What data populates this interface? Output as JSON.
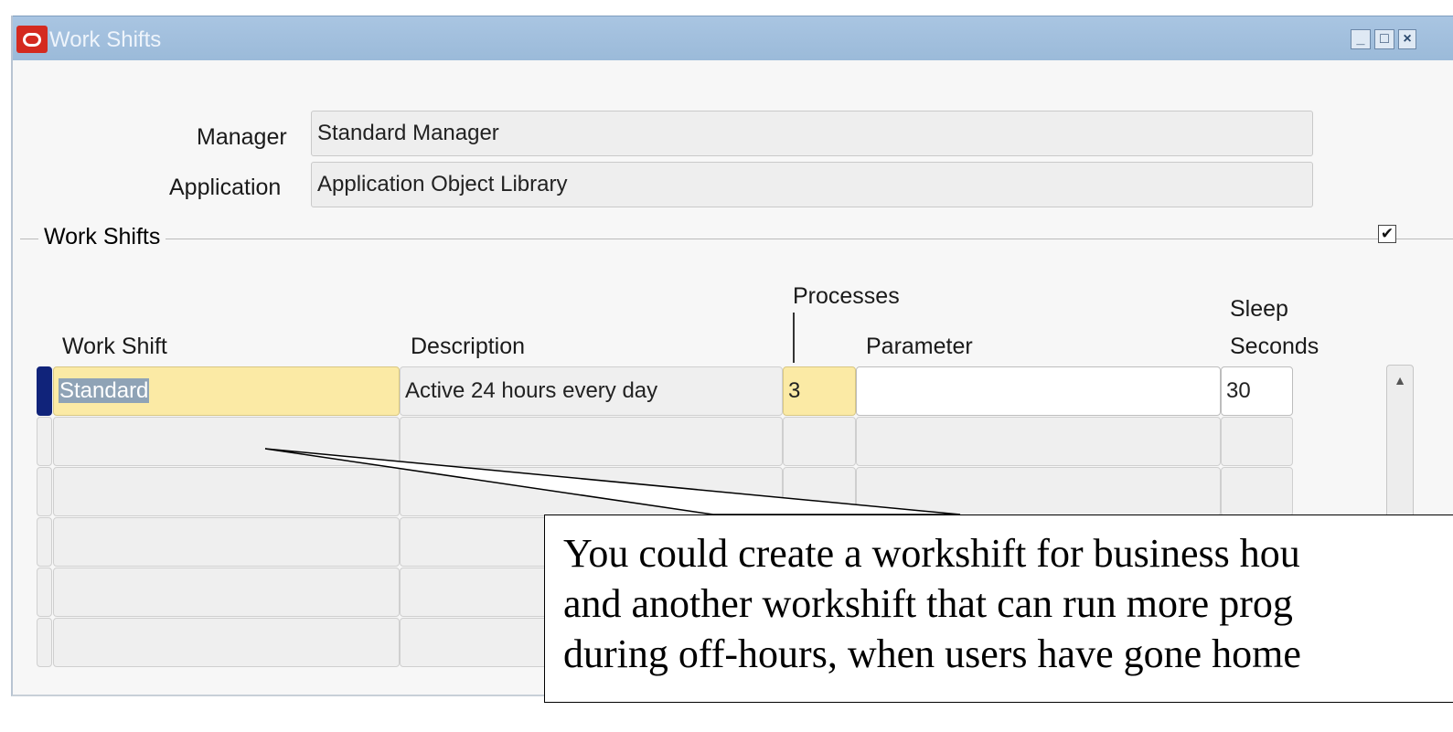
{
  "window": {
    "title": "Work Shifts",
    "controls": {
      "minimize": "_",
      "maximize": "□",
      "close": "×"
    }
  },
  "header_fields": {
    "manager_label": "Manager",
    "manager_value": "Standard Manager",
    "application_label": "Application",
    "application_value": "Application Object Library"
  },
  "section": {
    "title": "Work Shifts",
    "checkbox_checked": true,
    "checkbox_glyph": "✔"
  },
  "table": {
    "columns": {
      "work_shift": "Work Shift",
      "description": "Description",
      "processes": "Processes",
      "parameter": "Parameter",
      "sleep_line1": "Sleep",
      "sleep_line2": "Seconds"
    },
    "rows": [
      {
        "work_shift": "Standard",
        "description": "Active 24 hours every day",
        "processes": "3",
        "parameter": "",
        "sleep_seconds": "30"
      },
      {
        "work_shift": "",
        "description": "",
        "processes": "",
        "parameter": "",
        "sleep_seconds": ""
      },
      {
        "work_shift": "",
        "description": "",
        "processes": "",
        "parameter": "",
        "sleep_seconds": ""
      },
      {
        "work_shift": "",
        "description": "",
        "processes": "",
        "parameter": "",
        "sleep_seconds": ""
      },
      {
        "work_shift": "",
        "description": "",
        "processes": "",
        "parameter": "",
        "sleep_seconds": ""
      },
      {
        "work_shift": "",
        "description": "",
        "processes": "",
        "parameter": "",
        "sleep_seconds": ""
      }
    ],
    "scroll_up_glyph": "▲"
  },
  "callout": {
    "line1": "You could create a workshift for business hou",
    "line2": "and another workshift that can run more prog",
    "line3": "during off-hours, when users have gone home"
  },
  "colors": {
    "titlebar": "#a9c5e2",
    "required_field": "#fbeaa5",
    "current_row_indicator": "#10237a",
    "logo": "#d42a1f"
  }
}
